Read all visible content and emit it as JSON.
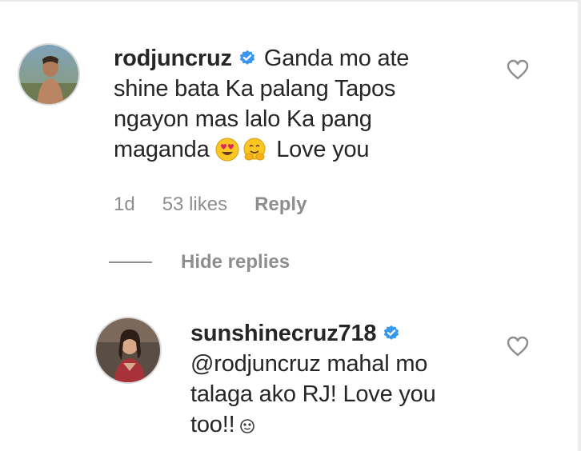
{
  "comments": [
    {
      "username": "rodjuncruz",
      "verified": true,
      "text_line1": "Ganda mo ate",
      "text_line2": "shine bata Ka palang Tapos",
      "text_line3": "ngayon mas lalo Ka pang",
      "text_line4_before": "maganda",
      "text_line4_after": "Love you",
      "emojis": [
        "heart-eyes-emoji",
        "smiling-hug-emoji"
      ],
      "time": "1d",
      "likes": "53 likes",
      "reply_label": "Reply",
      "hide_replies_label": "Hide replies"
    }
  ],
  "replies": [
    {
      "username": "sunshinecruz718",
      "verified": true,
      "text_line1": "@rodjuncruz mahal mo",
      "text_line2": "talaga ako RJ! Love you",
      "text_line3": "too!!",
      "emoji": "small-face-emoji"
    }
  ],
  "colors": {
    "text": "#262626",
    "meta": "#8e8e8e",
    "verified_blue": "#3897f0"
  }
}
